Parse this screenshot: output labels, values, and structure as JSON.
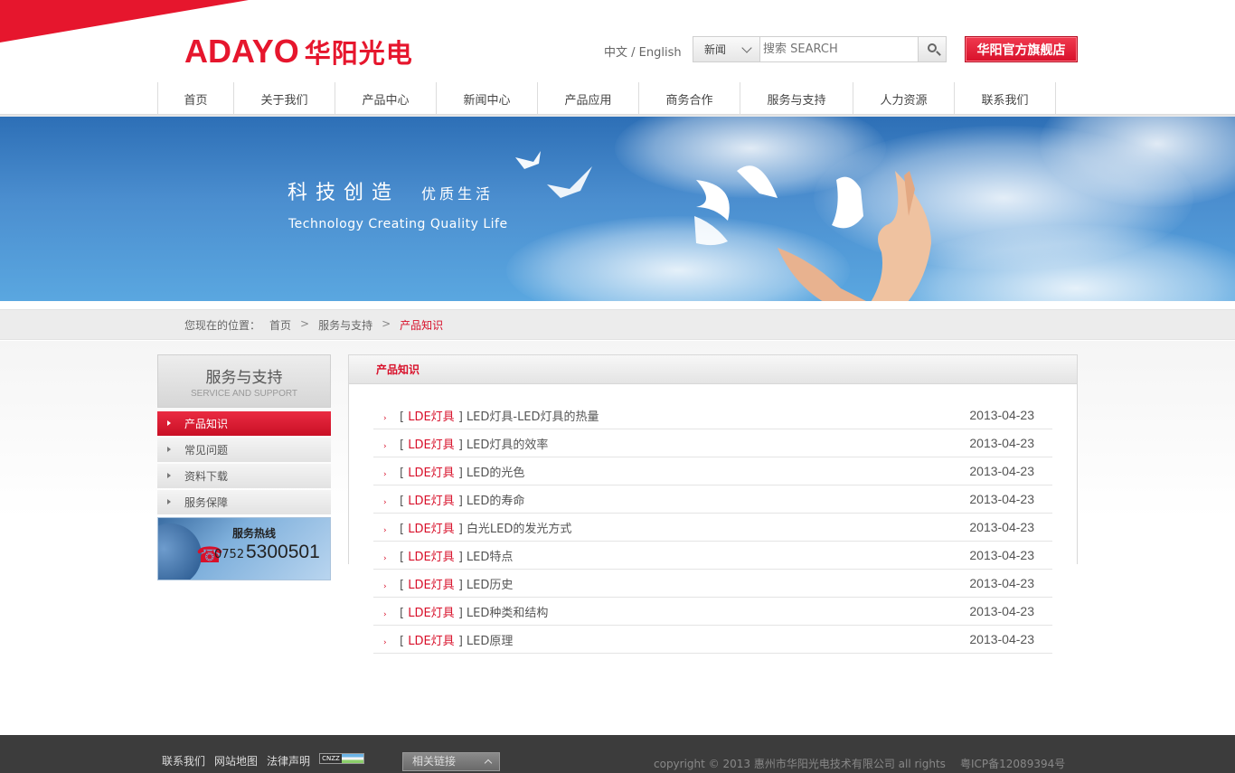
{
  "header": {
    "logo_en": "ADAYO",
    "logo_cn": "华阳光电",
    "lang": "中文 / English",
    "search": {
      "category": "新闻",
      "placeholder": "搜索 SEARCH"
    },
    "flagship_label": "华阳官方旗舰店"
  },
  "nav": {
    "items": [
      "首页",
      "关于我们",
      "产品中心",
      "新闻中心",
      "产品应用",
      "商务合作",
      "服务与支持",
      "人力资源",
      "联系我们"
    ]
  },
  "banner": {
    "slogan_cn": "科技创造",
    "slogan_cn2": "优质生活",
    "slogan_en": "Technology Creating Quality Life"
  },
  "breadcrumb": {
    "label": "您现在的位置：",
    "items": [
      "首页",
      "服务与支持",
      "产品知识"
    ],
    "separator": ">"
  },
  "sidebar": {
    "title_cn": "服务与支持",
    "title_en": "SERVICE AND SUPPORT",
    "items": [
      {
        "label": "产品知识",
        "active": true
      },
      {
        "label": "常见问题",
        "active": false
      },
      {
        "label": "资料下载",
        "active": false
      },
      {
        "label": "服务保障",
        "active": false
      }
    ],
    "hotline": {
      "title": "服务热线",
      "area_code": "0752",
      "number": "5300501"
    }
  },
  "content": {
    "heading": "产品知识",
    "articles": [
      {
        "tag": "LDE灯具",
        "title": "LED灯具-LED灯具的热量",
        "date": "2013-04-23"
      },
      {
        "tag": "LDE灯具",
        "title": "LED灯具的效率",
        "date": "2013-04-23"
      },
      {
        "tag": "LDE灯具",
        "title": "LED的光色",
        "date": "2013-04-23"
      },
      {
        "tag": "LDE灯具",
        "title": "LED的寿命",
        "date": "2013-04-23"
      },
      {
        "tag": "LDE灯具",
        "title": "白光LED的发光方式",
        "date": "2013-04-23"
      },
      {
        "tag": "LDE灯具",
        "title": "LED特点",
        "date": "2013-04-23"
      },
      {
        "tag": "LDE灯具",
        "title": "LED历史",
        "date": "2013-04-23"
      },
      {
        "tag": "LDE灯具",
        "title": "LED种类和结构",
        "date": "2013-04-23"
      },
      {
        "tag": "LDE灯具",
        "title": "LED原理",
        "date": "2013-04-23"
      }
    ]
  },
  "footer": {
    "links": [
      "联系我们",
      "网站地图",
      "法律声明"
    ],
    "cnzz_label": "CNZZ",
    "related_label": "相关链接",
    "copyright": "copyright © 2013 惠州市华阳光电技术有限公司 all rights",
    "icp": "粤ICP备12089394号"
  },
  "colors": {
    "brand_red": "#e6162d",
    "footer_bg": "#3c3c3c",
    "banner_blue": "#2d6fb6"
  },
  "icons": {
    "search": "search-icon",
    "chevron_down": "chevron-down-icon",
    "phone": "phone-icon",
    "arrow": "arrow-right-icon"
  }
}
